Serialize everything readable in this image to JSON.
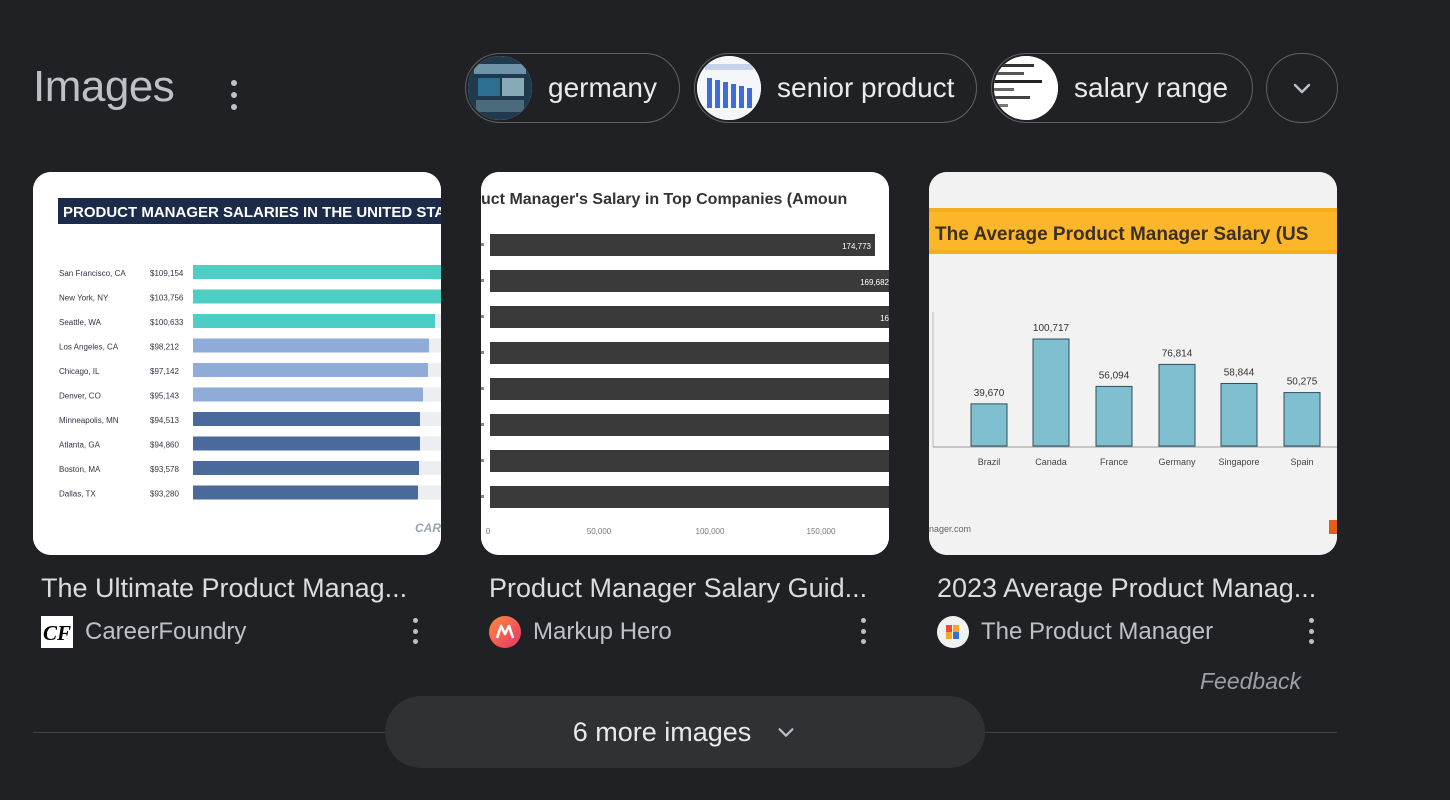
{
  "header": {
    "title": "Images"
  },
  "chips": [
    {
      "label": "germany"
    },
    {
      "label": "senior product"
    },
    {
      "label": "salary range"
    }
  ],
  "cards": [
    {
      "caption": "The Ultimate Product Manag...",
      "source": "CareerFoundry",
      "favicon_text": "CF",
      "thumb": {
        "title": "PRODUCT MANAGER SALARIES IN THE UNITED STATES",
        "rows": [
          {
            "city": "San Francisco, CA",
            "value": "$109,154"
          },
          {
            "city": "New York, NY",
            "value": "$103,756"
          },
          {
            "city": "Seattle, WA",
            "value": "$100,633"
          },
          {
            "city": "Los Angeles, CA",
            "value": "$98,212"
          },
          {
            "city": "Chicago, IL",
            "value": "$97,142"
          },
          {
            "city": "Denver, CO",
            "value": "$95,143"
          },
          {
            "city": "Minneapolis, MN",
            "value": "$94,513"
          },
          {
            "city": "Atlanta, GA",
            "value": "$94,860"
          },
          {
            "city": "Boston, MA",
            "value": "$93,578"
          },
          {
            "city": "Dallas, TX",
            "value": "$93,280"
          }
        ],
        "watermark": "CAR"
      }
    },
    {
      "caption": "Product Manager Salary Guid...",
      "source": "Markup Hero",
      "thumb": {
        "title": "uct Manager's Salary in Top Companies (Amoun",
        "bar_labels": [
          "174,773",
          "169,682",
          "16"
        ],
        "ticks": [
          "0",
          "50,000",
          "100,000",
          "150,000"
        ]
      }
    },
    {
      "caption": "2023 Average Product Manag...",
      "source": "The Product Manager",
      "thumb": {
        "title": "The Average Product Manager Salary (US",
        "categories": [
          "Brazil",
          "Canada",
          "France",
          "Germany",
          "Singapore",
          "Spain"
        ],
        "value_labels": [
          "39,670",
          "100,717",
          "56,094",
          "76,814",
          "58,844",
          "50,275"
        ],
        "values": [
          39670,
          100717,
          56094,
          76814,
          58844,
          50275
        ],
        "footer": "nager.com"
      }
    }
  ],
  "feedback": "Feedback",
  "more_button": "6 more images",
  "colors": {
    "background": "#202124",
    "text": "#e8eaed",
    "teal": "#4ecdc4",
    "light_blue": "#8fabd8",
    "dark_blue": "#4a6a9b",
    "bar_grey": "#3a3a3a",
    "orange_band": "#f5ae1b",
    "chart_bar": "#7fbfd0"
  }
}
